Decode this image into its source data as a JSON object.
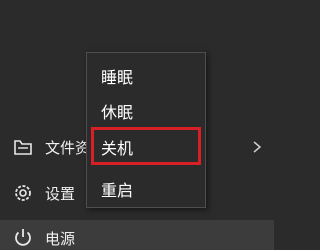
{
  "sidebar": {
    "items": [
      {
        "label": "文件资",
        "icon": "documents-folder-icon"
      },
      {
        "label": "设置",
        "icon": "gear-icon"
      },
      {
        "label": "电源",
        "icon": "power-icon"
      }
    ]
  },
  "power_menu": {
    "items": [
      {
        "label": "睡眠"
      },
      {
        "label": "休眠"
      },
      {
        "label": "关机",
        "highlighted": true
      },
      {
        "label": "重启"
      }
    ]
  },
  "colors": {
    "background": "#2b2b2b",
    "highlight_border": "#d81f26",
    "hover_background": "#3c3c3c",
    "text": "#ffffff"
  }
}
